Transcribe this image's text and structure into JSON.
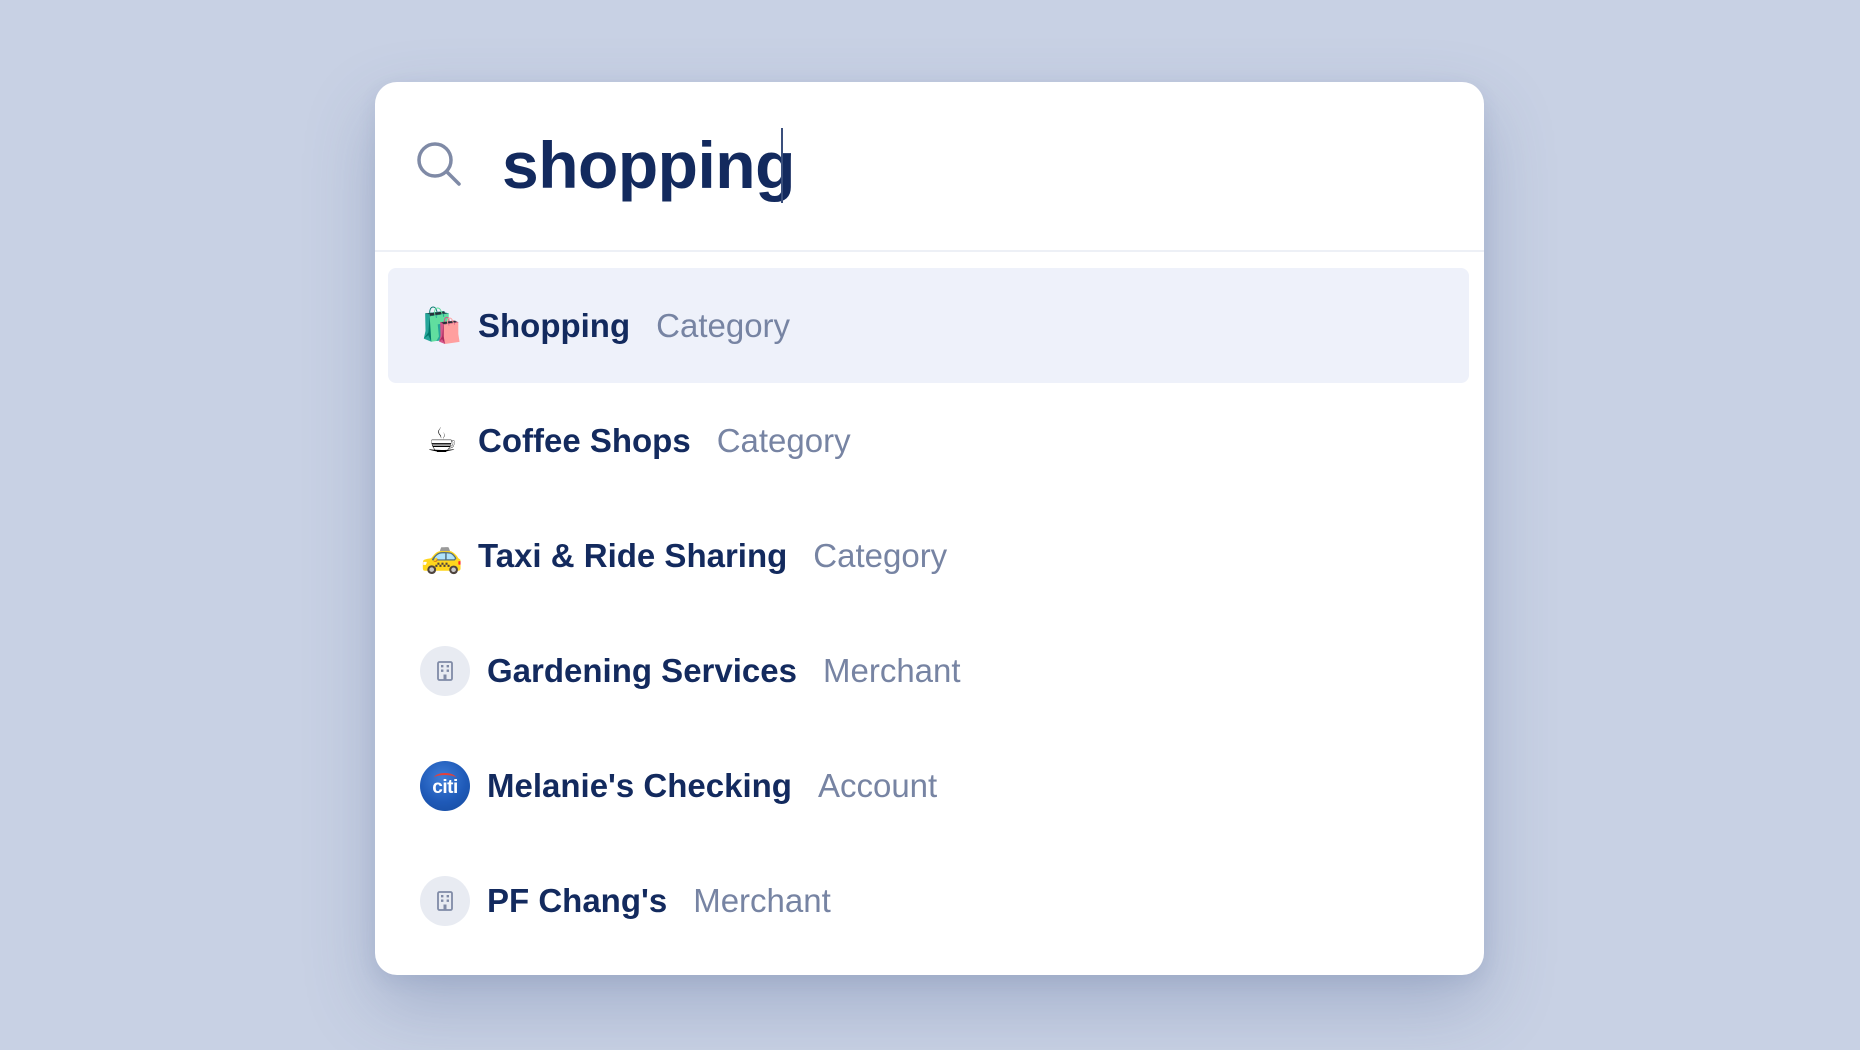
{
  "search": {
    "query": "shopping",
    "icon": "search-icon"
  },
  "results": [
    {
      "label": "Shopping",
      "type": "Category",
      "icon": "shopping-bags-icon",
      "glyph": "🛍️",
      "selected": true
    },
    {
      "label": "Coffee Shops",
      "type": "Category",
      "icon": "coffee-cup-icon",
      "glyph": "☕"
    },
    {
      "label": "Taxi & Ride Sharing",
      "type": "Category",
      "icon": "taxi-icon",
      "glyph": "🚕"
    },
    {
      "label": "Gardening Services",
      "type": "Merchant",
      "icon": "building-icon"
    },
    {
      "label": "Melanie's Checking",
      "type": "Account",
      "icon": "citi-logo-icon",
      "logo_text": "citi"
    },
    {
      "label": "PF Chang's",
      "type": "Merchant",
      "icon": "building-icon"
    }
  ],
  "colors": {
    "background": "#c8d1e4",
    "primary_text": "#132a5e",
    "secondary_text": "#7784a3",
    "selected_row": "#eef1fa"
  }
}
